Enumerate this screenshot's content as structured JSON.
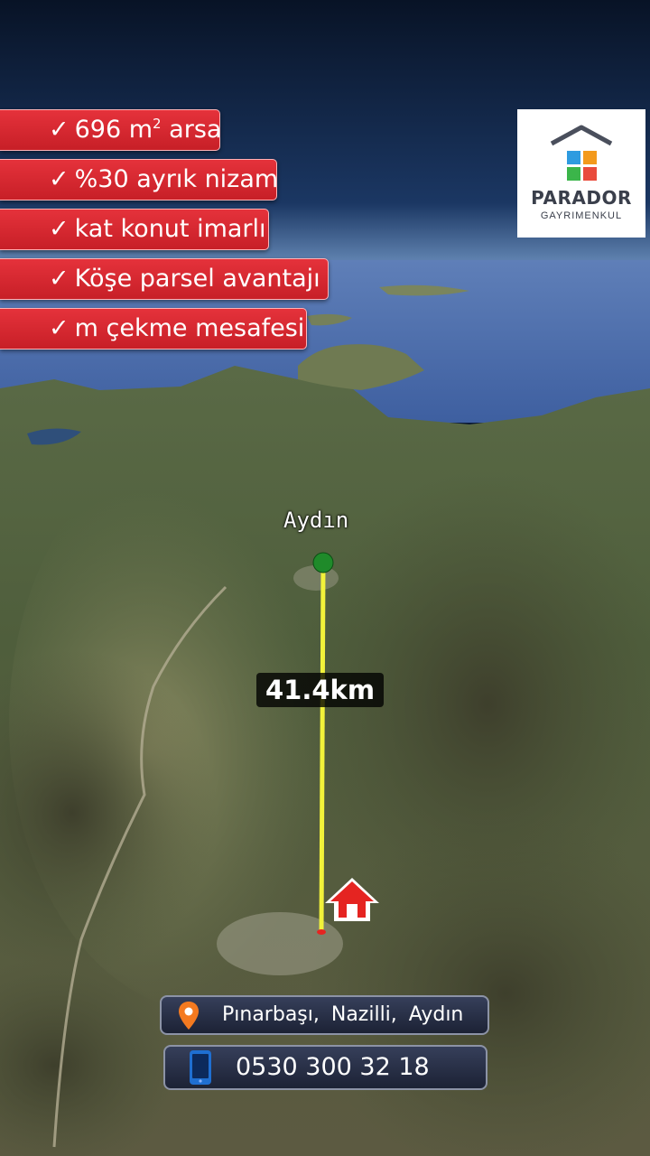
{
  "features": [
    {
      "prefix": "696 m",
      "sup": "2",
      "suffix": " arsa"
    },
    {
      "text": "%30 ayrık nizam"
    },
    {
      "text": "kat konut imarlı"
    },
    {
      "text": "Köşe parsel avantajı"
    },
    {
      "text": "m çekme mesafesi"
    }
  ],
  "check_mark": "✓",
  "logo": {
    "name": "PARADOR",
    "subtitle": "GAYRIMENKUL"
  },
  "map": {
    "city_label": "Aydın",
    "distance_label": "41.4km",
    "start_marker_color": "#1f8a2a",
    "line_color": "#f2f23a",
    "home_icon": "house-icon",
    "home_icon_color": "#e52421"
  },
  "location": {
    "icon": "map-pin-icon",
    "text": "Pınarbaşı,  Nazilli,  Aydın"
  },
  "phone": {
    "icon": "mobile-phone-icon",
    "text": "0530 300 32 18"
  }
}
